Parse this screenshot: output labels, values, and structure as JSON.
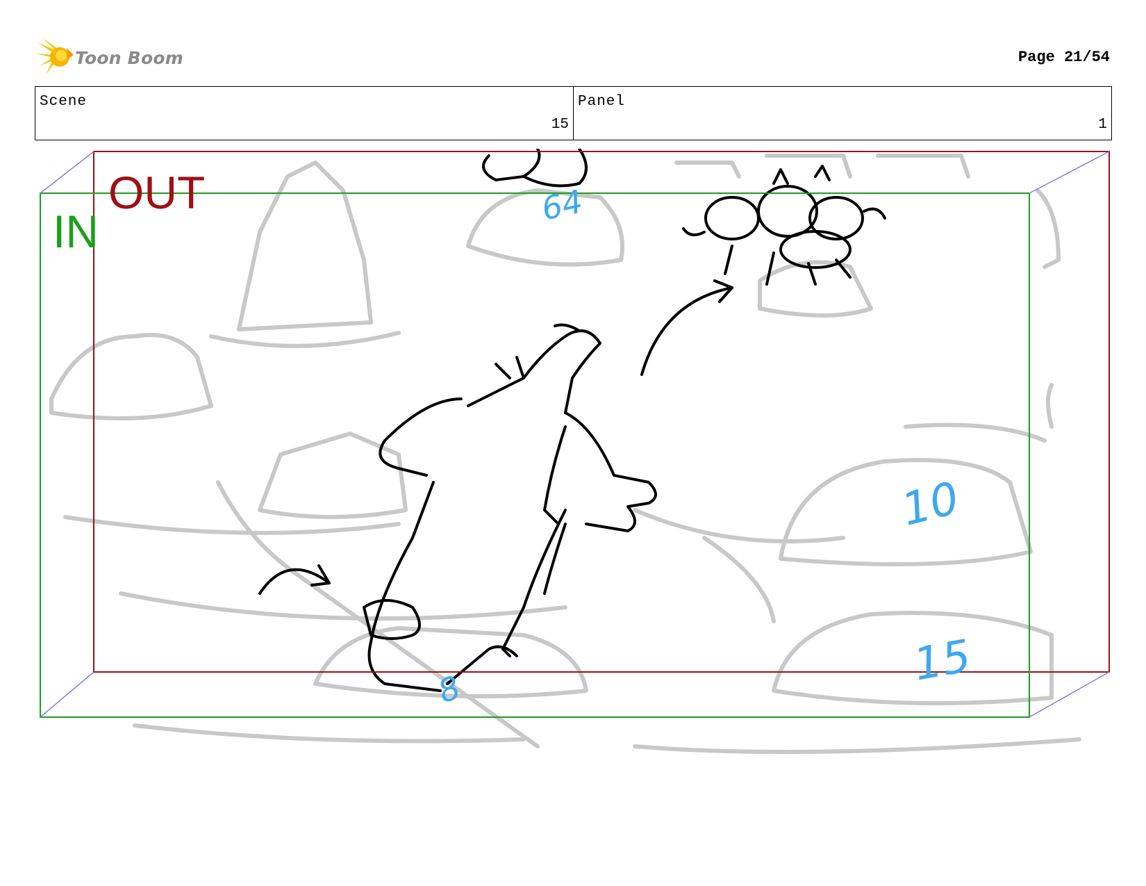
{
  "header": {
    "logo_text": "Toon Boom",
    "page_label": "Page 21/54"
  },
  "info": {
    "scene_label": "Scene",
    "scene_value": "15",
    "panel_label": "Panel",
    "panel_value": "1"
  },
  "panel": {
    "camera_in_label": "IN",
    "camera_out_label": "OUT",
    "annotations": [
      "64",
      "10",
      "15",
      "8"
    ],
    "colors": {
      "camera_in": "#19a019",
      "camera_out": "#a00f14",
      "annotation": "#3ea8ef"
    }
  }
}
